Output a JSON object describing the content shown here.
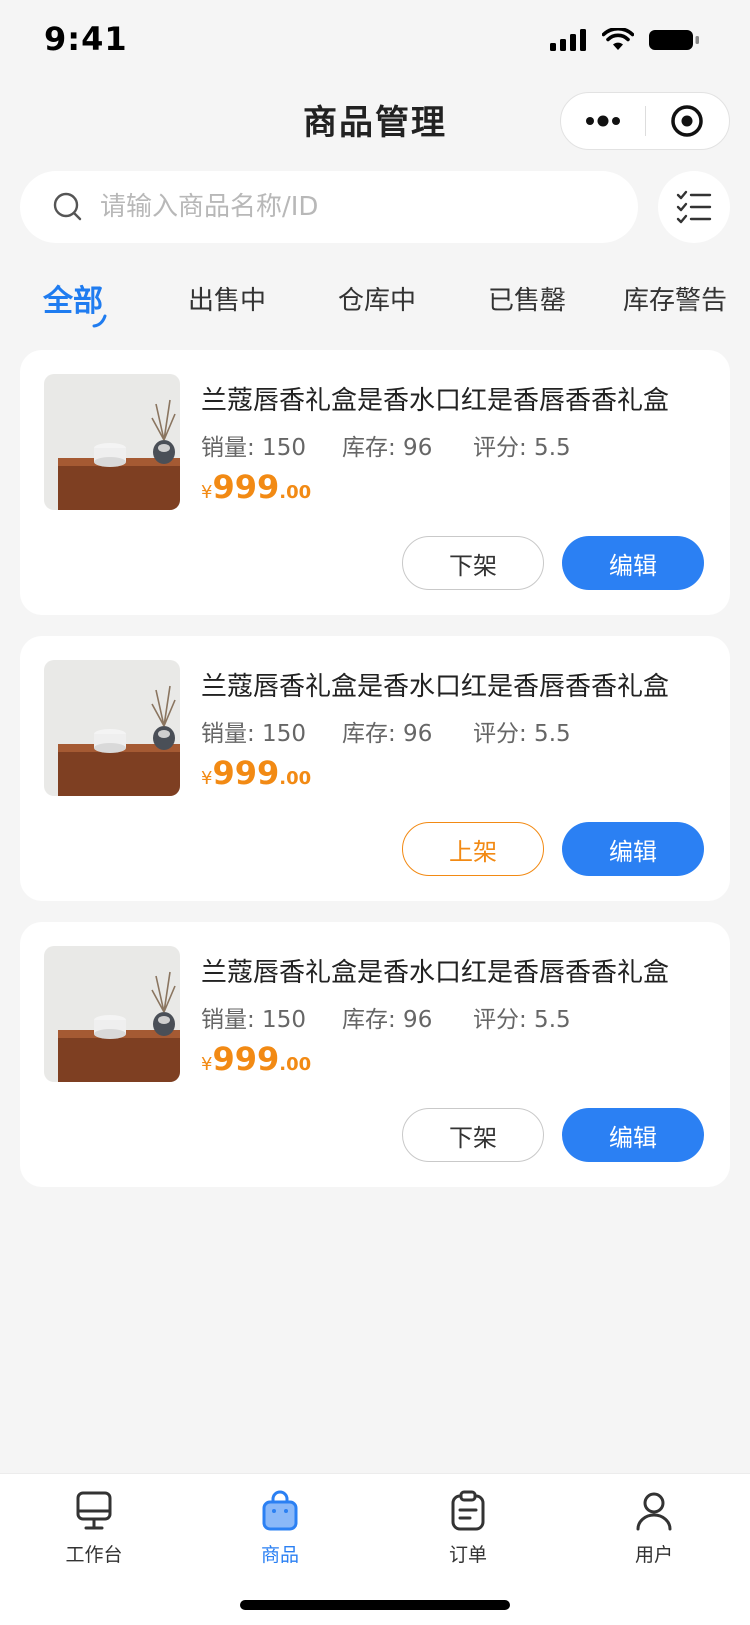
{
  "status_bar": {
    "time": "9:41"
  },
  "nav": {
    "title": "商品管理"
  },
  "search": {
    "placeholder": "请输入商品名称/ID"
  },
  "tabs": [
    {
      "label": "全部",
      "active": true
    },
    {
      "label": "出售中",
      "active": false
    },
    {
      "label": "仓库中",
      "active": false
    },
    {
      "label": "已售罄",
      "active": false
    },
    {
      "label": "库存警告",
      "active": false
    }
  ],
  "products": [
    {
      "title": "兰蔻唇香礼盒是香水口红是香唇香香礼盒",
      "sales_label": "销量: 150",
      "stock_label": "库存: 96",
      "rating_label": "评分: 5.5",
      "price_symbol": "¥",
      "price_int": "999",
      "price_dec": ".00",
      "status_button": "下架",
      "edit_button": "编辑"
    },
    {
      "title": "兰蔻唇香礼盒是香水口红是香唇香香礼盒",
      "sales_label": "销量: 150",
      "stock_label": "库存: 96",
      "rating_label": "评分: 5.5",
      "price_symbol": "¥",
      "price_int": "999",
      "price_dec": ".00",
      "status_button": "上架",
      "edit_button": "编辑"
    },
    {
      "title": "兰蔻唇香礼盒是香水口红是香唇香香礼盒",
      "sales_label": "销量: 150",
      "stock_label": "库存: 96",
      "rating_label": "评分: 5.5",
      "price_symbol": "¥",
      "price_int": "999",
      "price_dec": ".00",
      "status_button": "下架",
      "edit_button": "编辑"
    }
  ],
  "tabbar": [
    {
      "label": "工作台",
      "icon": "monitor-icon",
      "active": false
    },
    {
      "label": "商品",
      "icon": "shopping-bag-icon",
      "active": true
    },
    {
      "label": "订单",
      "icon": "clipboard-icon",
      "active": false
    },
    {
      "label": "用户",
      "icon": "user-icon",
      "active": false
    }
  ],
  "colors": {
    "accent": "#2b80f3",
    "price": "#f28a14",
    "background": "#f5f5f5"
  }
}
